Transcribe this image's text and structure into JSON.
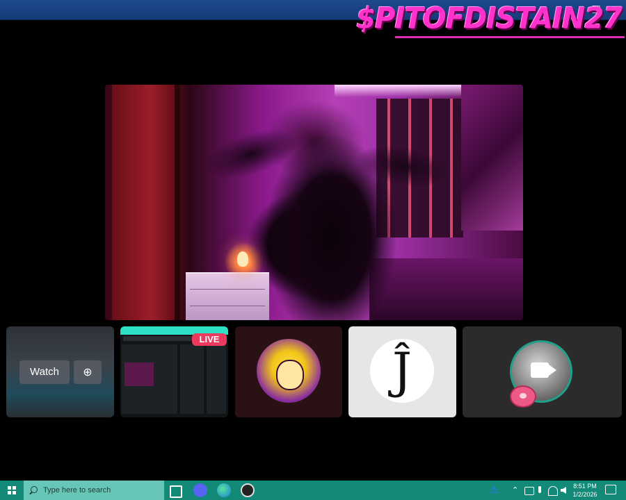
{
  "window": {
    "brand_text": "$PITOFDISTAIN27",
    "maximize_glyph": "☐",
    "close_glyph": "✕"
  },
  "tiles": {
    "watch_label": "Watch",
    "popout_glyph": "⊕",
    "live_badge": "LIVE",
    "avatar2_letter": "Ĵ"
  },
  "taskbar": {
    "search_placeholder": "Type here to search",
    "time": "8:51 PM",
    "date": "1/2/2026",
    "tray_chevron": "⌃",
    "warning_glyph": "⚠",
    "accent": "#128a77"
  },
  "colors": {
    "brand": "#ff33cc",
    "live": "#ea3a5d",
    "titlebar": "#1e4a8f"
  }
}
